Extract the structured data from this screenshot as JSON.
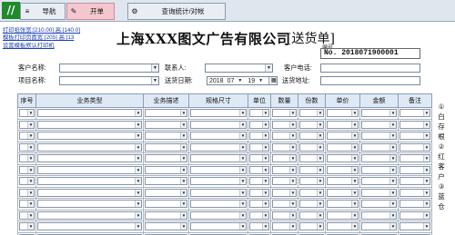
{
  "tabs": [
    {
      "icon": "≡",
      "label": "导航"
    },
    {
      "icon": "✎",
      "label": "开单"
    },
    {
      "icon": "⚙",
      "label": "查询统计/对帐"
    }
  ],
  "logo": "//",
  "print_links": [
    "打印纸张宽:[210.00] 高:[140.0]",
    "模板打印页面宽:[205] 高:[13",
    "设置模板默认打印机"
  ],
  "title": "上海XXX图文广告有限公司",
  "doc_type": "[送货单]",
  "serial_label": "编号",
  "serial_no": "No. 2018071900001",
  "form": {
    "customer_label": "客户名称:",
    "contact_label": "联系人:",
    "phone_label": "客户电话:",
    "project_label": "项目名称:",
    "date_label": "送货日期:",
    "address_label": "送货地址:",
    "date": {
      "year": "2018",
      "month": "07",
      "day": "19"
    }
  },
  "table": {
    "headers": [
      "序号",
      "业务类型",
      "业务描述",
      "规格尺寸",
      "单位",
      "数量",
      "份数",
      "单价",
      "金额",
      "备注"
    ],
    "row_count": 12
  },
  "side_note": [
    "①",
    "白",
    "存",
    "根",
    "②",
    "红",
    "客",
    "户",
    "③",
    "蓝",
    "仓"
  ]
}
